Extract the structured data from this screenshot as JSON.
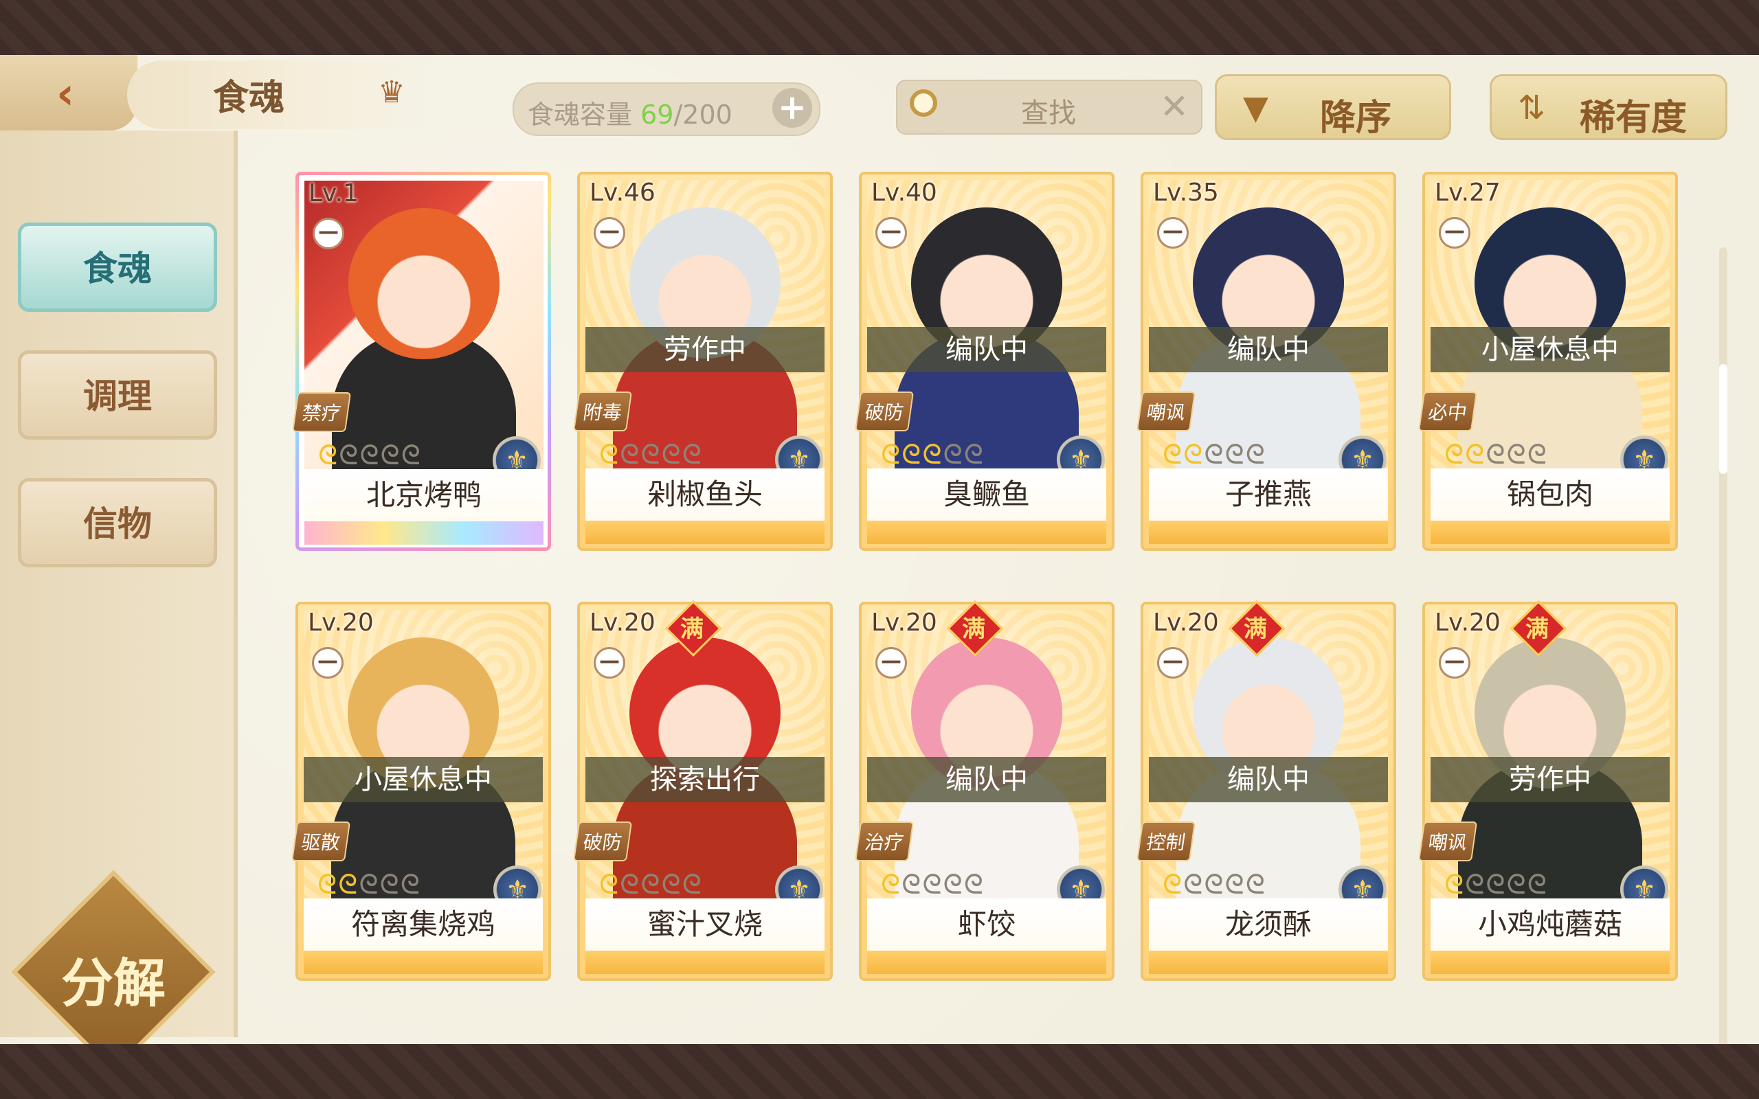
{
  "header": {
    "title": "食魂",
    "capacity_label": "食魂容量",
    "capacity_current": "69",
    "capacity_rest": "/200",
    "capacity_add": "+",
    "search_placeholder": "查找",
    "search_clear": "✕",
    "sort_order_label": "降序",
    "sort_by_label": "稀有度"
  },
  "sidebar": {
    "tabs": [
      {
        "label": "食魂",
        "active": true
      },
      {
        "label": "调理",
        "active": false
      },
      {
        "label": "信物",
        "active": false
      }
    ],
    "decompose_label": "分解"
  },
  "cards": [
    {
      "level": "Lv.1",
      "full": false,
      "full_label": "",
      "status": "",
      "skill": "禁疗",
      "stars": 1,
      "name": "北京烤鸭",
      "rainbow": true,
      "hair": "#e9642a",
      "outfit": "#2a2a2a"
    },
    {
      "level": "Lv.46",
      "full": false,
      "full_label": "",
      "status": "劳作中",
      "skill": "附毒",
      "stars": 1,
      "name": "剁椒鱼头",
      "rainbow": false,
      "hair": "#dfe3e6",
      "outfit": "#c7322a"
    },
    {
      "level": "Lv.40",
      "full": false,
      "full_label": "",
      "status": "编队中",
      "skill": "破防",
      "stars": 3,
      "name": "臭鳜鱼",
      "rainbow": false,
      "hair": "#2b2b2f",
      "outfit": "#2f3a7c"
    },
    {
      "level": "Lv.35",
      "full": false,
      "full_label": "",
      "status": "编队中",
      "skill": "嘲讽",
      "stars": 2,
      "name": "子推燕",
      "rainbow": false,
      "hair": "#2a3056",
      "outfit": "#e9ecef"
    },
    {
      "level": "Lv.27",
      "full": false,
      "full_label": "",
      "status": "小屋休息中",
      "skill": "必中",
      "stars": 2,
      "name": "锅包肉",
      "rainbow": false,
      "hair": "#1f2c4a",
      "outfit": "#f3e4c6"
    },
    {
      "level": "Lv.20",
      "full": false,
      "full_label": "",
      "status": "小屋休息中",
      "skill": "驱散",
      "stars": 2,
      "name": "符离集烧鸡",
      "rainbow": false,
      "hair": "#e7b45c",
      "outfit": "#2e2e2e"
    },
    {
      "level": "Lv.20",
      "full": true,
      "full_label": "满",
      "status": "探索出行",
      "skill": "破防",
      "stars": 1,
      "name": "蜜汁叉烧",
      "rainbow": false,
      "hair": "#d8312a",
      "outfit": "#b6321e"
    },
    {
      "level": "Lv.20",
      "full": true,
      "full_label": "满",
      "status": "编队中",
      "skill": "治疗",
      "stars": 1,
      "name": "虾饺",
      "rainbow": false,
      "hair": "#f29ab0",
      "outfit": "#f7f3f0"
    },
    {
      "level": "Lv.20",
      "full": true,
      "full_label": "满",
      "status": "编队中",
      "skill": "控制",
      "stars": 1,
      "name": "龙须酥",
      "rainbow": false,
      "hair": "#e6e8eb",
      "outfit": "#f3f1ec"
    },
    {
      "level": "Lv.20",
      "full": true,
      "full_label": "满",
      "status": "劳作中",
      "skill": "嘲讽",
      "stars": 1,
      "name": "小鸡炖蘑菇",
      "rainbow": false,
      "hair": "#c9c2a8",
      "outfit": "#2b2f2b"
    }
  ]
}
